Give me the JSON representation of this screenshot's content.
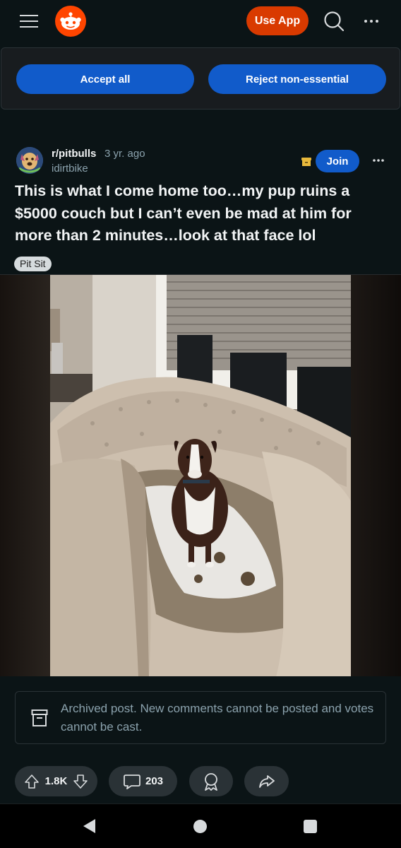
{
  "header": {
    "use_app_label": "Use App"
  },
  "cookie_banner": {
    "accept_label": "Accept all",
    "reject_label": "Reject non-essential"
  },
  "post": {
    "subreddit": "r/pitbulls",
    "time_ago": "3 yr. ago",
    "author": "idirtbike",
    "join_label": "Join",
    "title": "This is what I come home too…my pup ruins a $5000 couch but I can’t even be mad at him for more than 2 minutes…look at that face lol",
    "flair": "Pit Sit"
  },
  "archived_notice": {
    "text": "Archived post. New comments cannot be posted and votes cannot be cast."
  },
  "actions": {
    "vote_count": "1.8K",
    "comment_count": "203"
  },
  "colors": {
    "brand": "#ff4500",
    "use_app_bg": "#d93a00",
    "primary_button": "#115bca",
    "background": "#0b1416",
    "pill_bg": "#2a3236",
    "muted_text": "#8ba2ad"
  },
  "icons": {
    "menu": "hamburger-menu-icon",
    "logo": "reddit-logo-icon",
    "search": "search-icon",
    "more": "more-horizontal-icon",
    "archive": "archive-box-icon",
    "upvote": "upvote-arrow-icon",
    "downvote": "downvote-arrow-icon",
    "comment": "comment-bubble-icon",
    "award": "award-icon",
    "share": "share-arrow-icon",
    "nav_back": "android-back-icon",
    "nav_home": "android-home-icon",
    "nav_recent": "android-recent-apps-icon"
  }
}
